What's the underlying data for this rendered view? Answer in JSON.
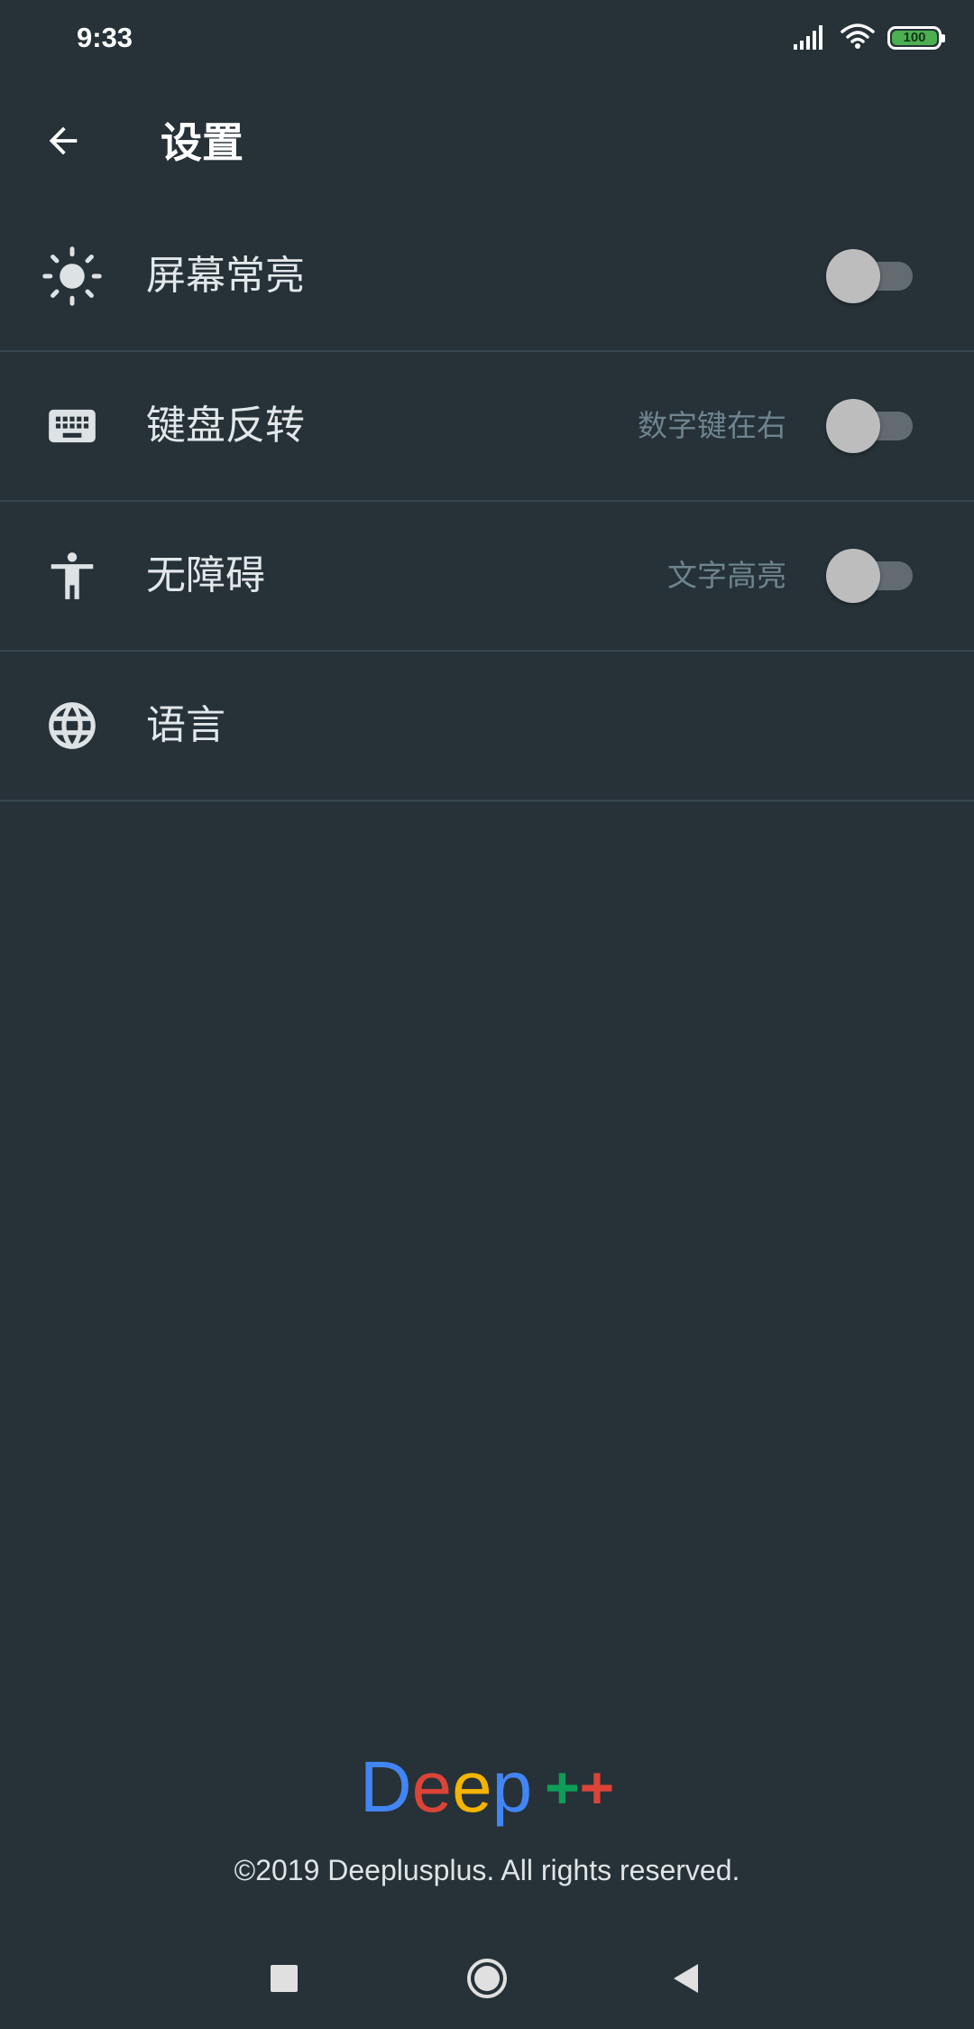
{
  "status_bar": {
    "time": "9:33",
    "battery_level": "100",
    "icons": [
      "signal-icon",
      "wifi-icon",
      "battery-icon"
    ],
    "battery_color": "#4caf50"
  },
  "toolbar": {
    "title": "设置",
    "back_icon": "arrow-back-icon"
  },
  "settings": [
    {
      "label": "屏幕常亮",
      "hint": "",
      "icon": "brightness-icon",
      "toggle": false
    },
    {
      "label": "键盘反转",
      "hint": "数字键在右",
      "icon": "keyboard-icon",
      "toggle": false
    },
    {
      "label": "无障碍",
      "hint": "文字高亮",
      "icon": "accessibility-icon",
      "toggle": false
    },
    {
      "label": "语言",
      "hint": "",
      "icon": "globe-icon"
    }
  ],
  "footer": {
    "logo": {
      "letters": [
        "D",
        "e",
        "e",
        "p",
        "+",
        "+"
      ],
      "colors": [
        "#4285f4",
        "#db4437",
        "#f4b400",
        "#4285f4",
        "#0f9d58",
        "#db4437"
      ]
    },
    "copyright": "©2019 Deeplusplus. All rights reserved."
  },
  "nav_bar": {
    "icons": [
      "recents-icon",
      "home-icon",
      "back-icon"
    ]
  },
  "colors": {
    "background": "#263238",
    "divider": "#37474f",
    "hint_text": "#6f848f",
    "switch_track": "#616b70",
    "switch_thumb": "#bdbdbd"
  }
}
